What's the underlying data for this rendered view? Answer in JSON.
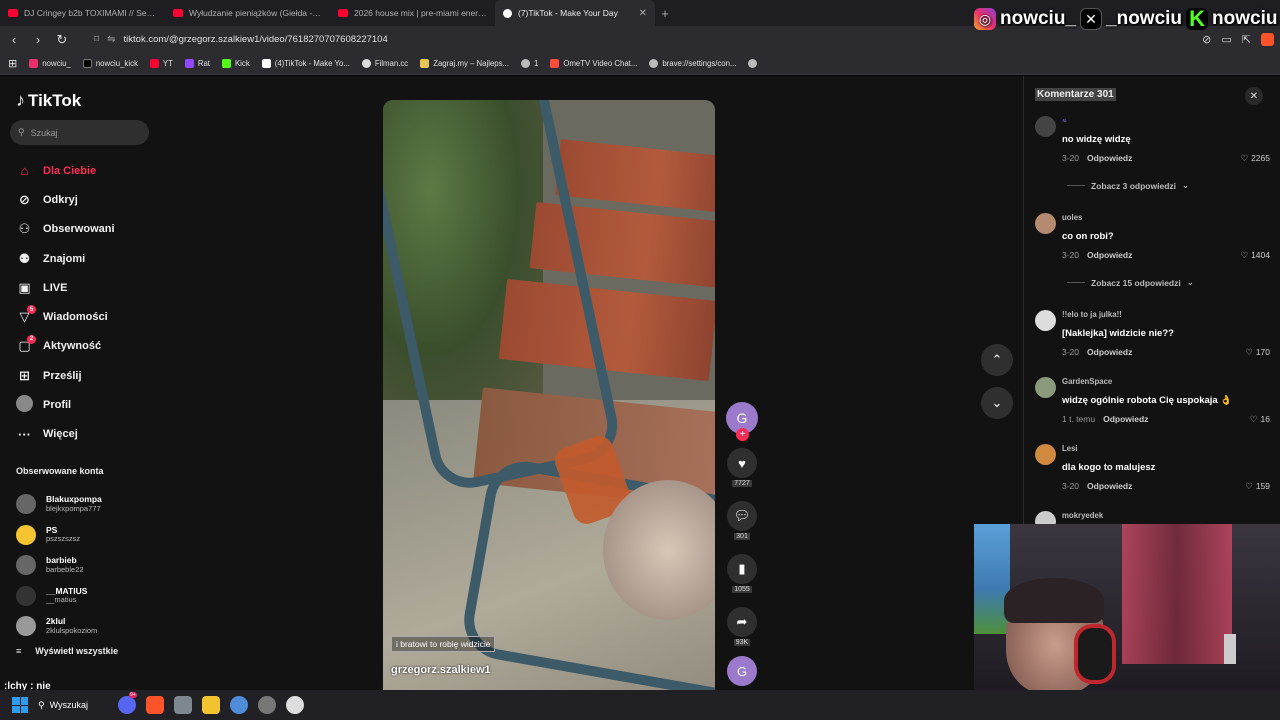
{
  "browser": {
    "tabs": [
      {
        "title": "DJ Cringey b2b TOXIMAMI // Sexpresso",
        "type": "youtube"
      },
      {
        "title": "Wyłudzanie pieniążków (Giełda - Od",
        "type": "youtube"
      },
      {
        "title": "2026 house mix | pre-miami energy",
        "type": "youtube"
      },
      {
        "title": "(7)TikTok - Make Your Day",
        "type": "tiktok",
        "active": true
      }
    ],
    "new_tab": "+",
    "url": "tiktok.com/@grzegorz.szalkiew1/video/7618270707608227104",
    "bookmarks": [
      "nowciu_",
      "nowciu_kick",
      "YT",
      "Rat",
      "Kick",
      "(4)TikTok - Make Yo...",
      "Filman.cc",
      "Zagraj.my – Najleps...",
      "1",
      "OmeTV Video Chat...",
      "brave://settings/con..."
    ]
  },
  "social_overlay": {
    "instagram": "nowciu_",
    "x": "_nowciu",
    "kick": "nowciu"
  },
  "sidebar": {
    "logo": "TikTok",
    "search_placeholder": "Szukaj",
    "nav": [
      {
        "label": "Dla Ciebie",
        "icon": "home-icon",
        "active": true
      },
      {
        "label": "Odkryj",
        "icon": "compass-icon"
      },
      {
        "label": "Obserwowani",
        "icon": "following-icon"
      },
      {
        "label": "Znajomi",
        "icon": "friends-icon"
      },
      {
        "label": "LIVE",
        "icon": "live-icon"
      },
      {
        "label": "Wiadomości",
        "icon": "messages-icon",
        "badge": "5"
      },
      {
        "label": "Aktywność",
        "icon": "activity-icon",
        "badge": "2"
      },
      {
        "label": "Prześlij",
        "icon": "upload-icon"
      },
      {
        "label": "Profil",
        "icon": "profile-icon"
      },
      {
        "label": "Więcej",
        "icon": "more-icon"
      }
    ],
    "following_header": "Obserwowane konta",
    "following": [
      {
        "name": "Blakuxpompa",
        "user": "blejkxpompa777"
      },
      {
        "name": "PS",
        "user": "pszszszsz"
      },
      {
        "name": "barbieb",
        "user": "barbeble22"
      },
      {
        "name": "__MATIUS",
        "user": "__matius"
      },
      {
        "name": "2klul",
        "user": "2klulspokoziom"
      }
    ],
    "show_all": "Wyświetl wszystkie"
  },
  "video": {
    "caption": "i bratowi to robię widzicie",
    "author": "grzegorz.szalkiew1",
    "creator_initial": "G",
    "likes": "7727",
    "comments": "301",
    "saves": "1055",
    "shares": "93K"
  },
  "comments": {
    "header": "Komentarze 301",
    "items": [
      {
        "user": "⍨",
        "text": "no widzę widzę",
        "date": "3-20",
        "likes": "2265",
        "more": "Zobacz 3 odpowiedzi"
      },
      {
        "user": "uoles",
        "text": "co on robi?",
        "date": "3-20",
        "likes": "1404",
        "more": "Zobacz 15 odpowiedzi"
      },
      {
        "user": "!!elo to ja julka!!",
        "text": "[Naklejka] widzicie nie??",
        "date": "3-20",
        "likes": "170"
      },
      {
        "user": "GardenSpace",
        "text": "widzę ogólnie robota Cię uspokaja 👌",
        "date": "1 t. temu",
        "likes": "16"
      },
      {
        "user": "Lesi",
        "text": "dla kogo to malujesz",
        "date": "3-20",
        "likes": "159"
      },
      {
        "user": "mokryedek",
        "text": "",
        "date": "",
        "likes": ""
      }
    ],
    "reply_label": "Odpowiedz"
  },
  "chat_overlay": ":lchy : nie",
  "taskbar": {
    "search_label": "Wyszukaj",
    "discord_badge": "9+"
  },
  "colors": {
    "accent": "#fe2c55",
    "background": "#121212"
  }
}
